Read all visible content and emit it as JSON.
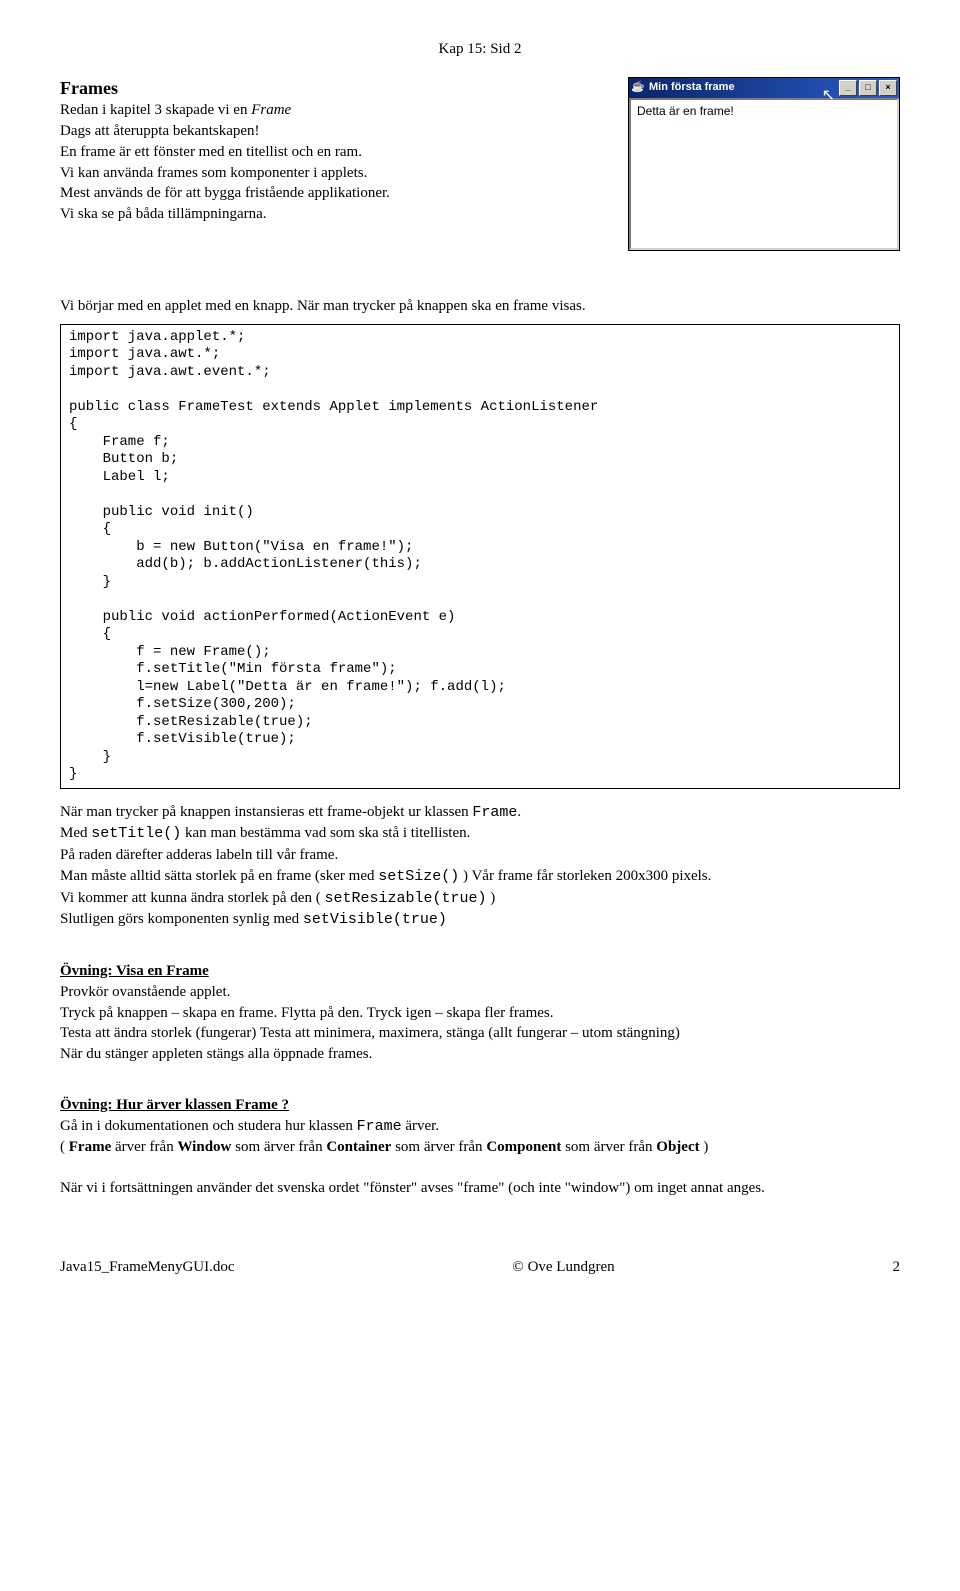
{
  "header": "Kap 15:  Sid 2",
  "section_title": "Frames",
  "intro": {
    "l1a": "Redan i kapitel 3 skapade vi en ",
    "l1b": "Frame",
    "l2": "Dags att återuppta bekantskapen!",
    "l3": "En frame är ett fönster med en titellist och en ram.",
    "l4": "Vi kan använda frames som  komponenter i applets.",
    "l5": "Mest används de för att bygga fristående applikationer.",
    "l6": "Vi ska se på båda tillämpningarna."
  },
  "screenshot": {
    "title": "Min första frame",
    "content": "Detta är en frame!",
    "btn_min": "_",
    "btn_max": "□",
    "btn_close": "×",
    "icon": "☕"
  },
  "pre_code_line": "Vi börjar med en applet med en knapp. När man trycker på knappen ska en frame visas.",
  "code": "import java.applet.*;\nimport java.awt.*;\nimport java.awt.event.*;\n\npublic class FrameTest extends Applet implements ActionListener\n{\n    Frame f;\n    Button b;\n    Label l;\n\n    public void init()\n    {\n        b = new Button(\"Visa en frame!\");\n        add(b); b.addActionListener(this);\n    }\n\n    public void actionPerformed(ActionEvent e)\n    {\n        f = new Frame();\n        f.setTitle(\"Min första frame\");\n        l=new Label(\"Detta är en frame!\"); f.add(l);\n        f.setSize(300,200);\n        f.setResizable(true);\n        f.setVisible(true);\n    }\n}",
  "post": {
    "p1a": "När man trycker på knappen instansieras ett frame-objekt ur klassen ",
    "p1b": "Frame",
    "p1c": ".",
    "p2a": "Med  ",
    "p2b": "setTitle()",
    "p2c": " kan man bestämma vad som ska stå i titellisten.",
    "p3": "På raden därefter adderas labeln till vår frame.",
    "p4a": "Man måste alltid sätta storlek på en frame (sker med ",
    "p4b": "setSize()",
    "p4c": " ) Vår frame får storleken 200x300 pixels.",
    "p5a": "Vi kommer att kunna ändra storlek på den ( ",
    "p5b": "setResizable(true)",
    "p5c": "  )",
    "p6a": "Slutligen görs komponenten synlig med ",
    "p6b": "setVisible(true)"
  },
  "ex1": {
    "head": "Övning: Visa en Frame",
    "l1": "Provkör ovanstående applet.",
    "l2": "Tryck på knappen – skapa en frame. Flytta på den. Tryck igen – skapa fler  frames.",
    "l3": "Testa att ändra storlek (fungerar)       Testa att minimera, maximera, stänga (allt fungerar – utom stängning)",
    "l4": "När du stänger appleten stängs alla öppnade frames."
  },
  "ex2": {
    "head": "Övning: Hur ärver klassen Frame ?",
    "l1a": "Gå in i dokumentationen och studera hur klassen ",
    "l1b": "Frame",
    "l1c": " ärver.",
    "l2a": "( ",
    "l2b": "Frame",
    "l2c": " ärver från ",
    "l2d": "Window",
    "l2e": " som ärver från ",
    "l2f": "Container",
    "l2g": " som ärver från ",
    "l2h": "Component",
    "l2i": " som ärver från ",
    "l2j": "Object",
    "l2k": " )"
  },
  "closing": "När vi i fortsättningen använder det svenska ordet \"fönster\" avses \"frame\" (och inte \"window\") om inget annat anges.",
  "footer": {
    "left": "Java15_FrameMenyGUI.doc",
    "center": "© Ove Lundgren",
    "right": "2"
  }
}
